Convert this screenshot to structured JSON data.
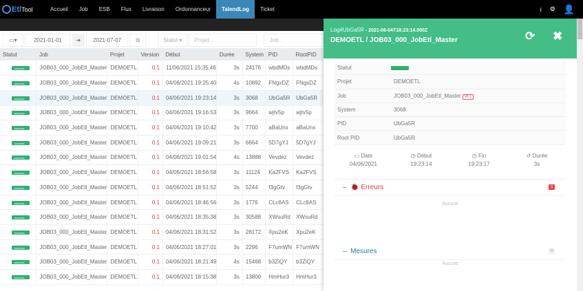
{
  "nav": {
    "logo_a": "Etl",
    "logo_b": "Tool",
    "items": [
      "Accueil",
      "Job",
      "ESB",
      "Flux",
      "Livraison",
      "Ordonnanceur",
      "TalendLog",
      "Ticket"
    ],
    "active": "TalendLog",
    "icons": [
      "info-icon",
      "gear-icon",
      "user-icon"
    ]
  },
  "filters": {
    "date_from": "2021-01-01",
    "date_to": "2021-07-07",
    "statut": "Statut ▾",
    "projet_placeholder": "Projet...",
    "job_placeholder": "Job..."
  },
  "table": {
    "headers": [
      "Statut",
      "Job",
      "Projet",
      "Version",
      "Début",
      "Durée",
      "System",
      "PID",
      "RootPID"
    ],
    "rows": [
      [
        "success",
        "JOB03_000_JobEtl_Master",
        "DEMOETL",
        "0.1",
        "11/06/2021 15:35:46",
        "3s",
        "24176",
        "wbdMDs",
        "wbdMDs"
      ],
      [
        "success",
        "JOB03_000_JobEtl_Master",
        "DEMOETL",
        "0.1",
        "04/06/2021 19:25:40",
        "4s",
        "10892",
        "FNgxDZ",
        "FNgxDZ"
      ],
      [
        "success",
        "JOB03_000_JobEtl_Master",
        "DEMOETL",
        "0.1",
        "04/06/2021 19:23:14",
        "3s",
        "3068",
        "UbGa5R",
        "UbGa5R"
      ],
      [
        "success",
        "JOB03_000_JobEtl_Master",
        "DEMOETL",
        "0.1",
        "04/06/2021 19:16:53",
        "3s",
        "9664",
        "wjtv5p",
        "wjtv5p"
      ],
      [
        "success",
        "JOB03_000_JobEtl_Master",
        "DEMOETL",
        "0.1",
        "04/06/2021 19:10:42",
        "3s",
        "7700",
        "aBaUnx",
        "aBaUnx"
      ],
      [
        "success",
        "JOB03_000_JobEtl_Master",
        "DEMOETL",
        "0.1",
        "04/06/2021 19:09:21",
        "3s",
        "6664",
        "5D7gYJ",
        "5D7gYJ"
      ],
      [
        "success",
        "JOB03_000_JobEtl_Master",
        "DEMOETL",
        "0.1",
        "04/06/2021 19:01:54",
        "4s",
        "13888",
        "Vevdez",
        "Vevdez"
      ],
      [
        "success",
        "JOB03_000_JobEtl_Master",
        "DEMOETL",
        "0.1",
        "04/06/2021 18:56:58",
        "3s",
        "11124",
        "Ka2FVS",
        "Ka2FVS"
      ],
      [
        "success",
        "JOB03_000_JobEtl_Master",
        "DEMOETL",
        "0.1",
        "04/06/2021 18:51:52",
        "3s",
        "5244",
        "f3gGtv",
        "f3gGtv"
      ],
      [
        "success",
        "JOB03_000_JobEtl_Master",
        "DEMOETL",
        "0.1",
        "04/06/2021 18:46:56",
        "3s",
        "1776",
        "CLc8AS",
        "CLc8AS"
      ],
      [
        "success",
        "JOB03_000_JobEtl_Master",
        "DEMOETL",
        "0.1",
        "04/06/2021 18:35:38",
        "3s",
        "30588",
        "XWsuRd",
        "XWsuRd"
      ],
      [
        "success",
        "JOB03_000_JobEtl_Master",
        "DEMOETL",
        "0.1",
        "04/06/2021 18:31:52",
        "3s",
        "28172",
        "Xpu2eK",
        "Xpu2eK"
      ],
      [
        "success",
        "JOB03_000_JobEtl_Master",
        "DEMOETL",
        "0.1",
        "04/06/2021 18:27:01",
        "3s",
        "2296",
        "F7umWN",
        "F7umWN"
      ],
      [
        "success",
        "JOB03_000_JobEtl_Master",
        "DEMOETL",
        "0.1",
        "04/06/2021 18:21:49",
        "4s",
        "15468",
        "b3ZiQY",
        "b3ZiQY"
      ],
      [
        "success",
        "JOB03_000_JobEtl_Master",
        "DEMOETL",
        "0.1",
        "04/06/2021 18:15:38",
        "3s",
        "13800",
        "HmHur3",
        "HmHur3"
      ]
    ],
    "selected_index": 2
  },
  "panel": {
    "log_id": "Log#UbGa5R",
    "timestamp": " - 2021-06-04T18:23:14.000Z",
    "title": "DEMOETL / JOB03_000_JobEtl_Master",
    "details": [
      {
        "label": "Statut",
        "value": "success"
      },
      {
        "label": "Projet",
        "value": "DEMOETL"
      },
      {
        "label": "Job",
        "value": "JOB03_000_JobEtl_Master",
        "tag": "V0.1"
      },
      {
        "label": "System",
        "value": "3068"
      },
      {
        "label": "PID",
        "value": "UbGa5R"
      },
      {
        "label": "Root PID",
        "value": "UbGa5R"
      }
    ],
    "times": [
      {
        "label": "Date",
        "value": "04/06/2021",
        "icon": "calendar-icon"
      },
      {
        "label": "Début",
        "value": "19:23:14",
        "icon": "clock-icon"
      },
      {
        "label": "Fin",
        "value": "19:23:17",
        "icon": "clock-icon"
      },
      {
        "label": "Durée",
        "value": "3s",
        "icon": "history-icon"
      }
    ],
    "errors": {
      "title": "Erreurs",
      "count": "0",
      "empty": "Aucune"
    },
    "measures": {
      "title": "Mesures",
      "count": "0",
      "empty": "Aucune"
    }
  },
  "colors": {
    "header_green": "#45bd87",
    "success": "#2fb073",
    "active_nav": "#3a87b8",
    "error": "#e33"
  }
}
